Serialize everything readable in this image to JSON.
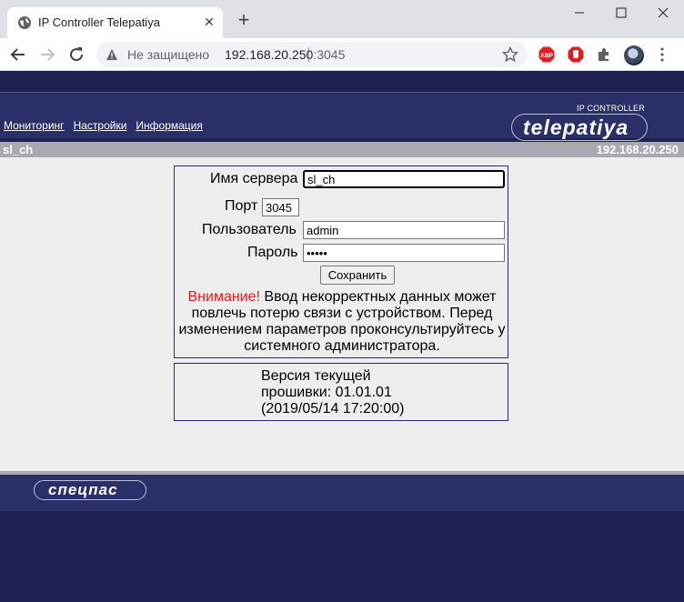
{
  "browser": {
    "tab_title": "IP Controller Telepatiya",
    "security_text": "Не защищено",
    "url_host": "192.168.20.250",
    "url_port": ":3045",
    "abp_label": "ABP"
  },
  "header": {
    "menu": [
      "Мониторинг",
      "Настройки",
      "Информация"
    ],
    "logo_sub": "IP CONTROLLER",
    "logo": "telepatiya"
  },
  "statusbar": {
    "name": "sl_ch",
    "ip": "192.168.20.250"
  },
  "form": {
    "server_name_label": "Имя сервера",
    "server_name_value": "sl_ch",
    "port_label": "Порт",
    "port_value": "3045",
    "user_label": "Пользователь",
    "user_value": "admin",
    "password_label": "Пароль",
    "password_value": "•••••",
    "save_label": "Сохранить",
    "warning_prefix": "Внимание!",
    "warning_text": " Ввод некорректных данных может повлечь потерю связи с устройством. Перед изменением параметров проконсультируйтесь у системного администратора."
  },
  "version": {
    "line1": "Версия текущей",
    "line2": "прошивки: 01.01.01",
    "line3": "(2019/05/14 17:20:00)"
  },
  "footer": {
    "logo": "спецпас"
  }
}
